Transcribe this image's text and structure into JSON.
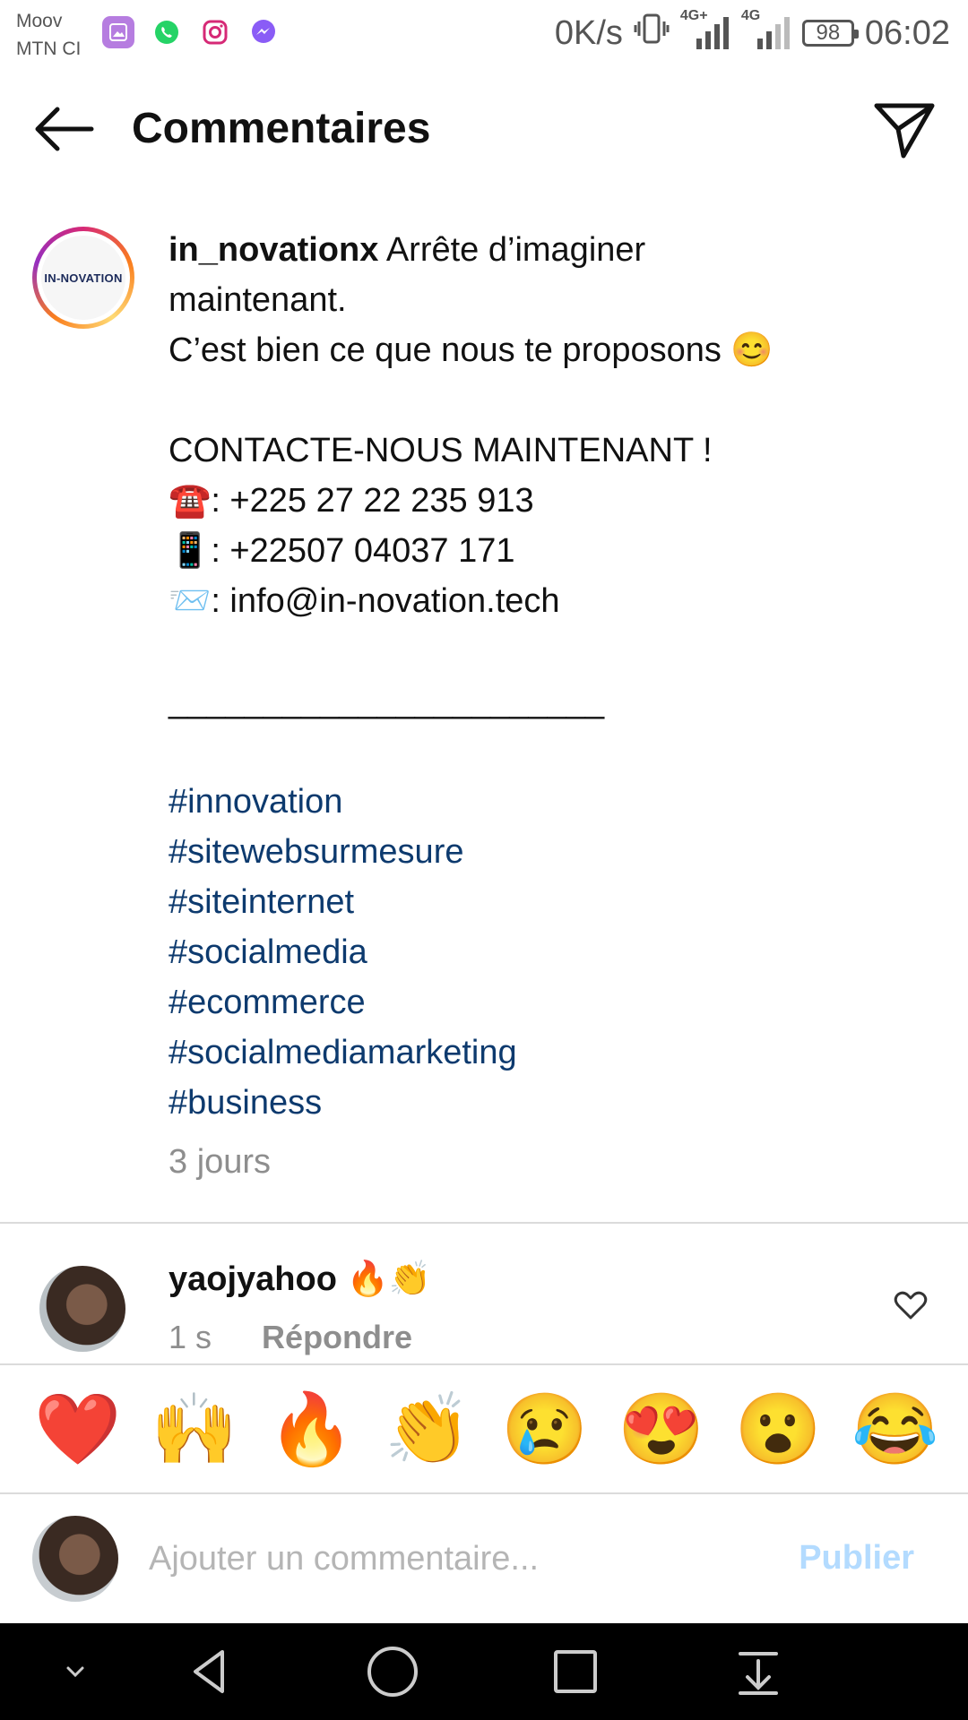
{
  "status_bar": {
    "carrier_line1": "Moov",
    "carrier_line2": "MTN CI",
    "net_speed": "0K/s",
    "battery": "98",
    "time": "06:02",
    "network_1": "4G+",
    "network_2": "4G"
  },
  "header": {
    "title": "Commentaires"
  },
  "caption": {
    "username": "in_novationx",
    "avatar_text": "IN-NOVATION",
    "lines": [
      " Arrête d’imaginer",
      "maintenant.",
      "C’est bien ce que nous te proposons 😊",
      "",
      "CONTACTE-NOUS MAINTENANT !",
      "☎️: +225 27 22 235 913",
      "📱: +22507 04037 171",
      "📨: info@in-novation.tech",
      "",
      "_______________________",
      ""
    ],
    "hashtags": [
      "#innovation",
      "#sitewebsurmesure",
      "#siteinternet",
      "#socialmedia",
      "#ecommerce",
      "#socialmediamarketing",
      "#business"
    ],
    "time": "3 jours"
  },
  "comment": {
    "username": "yaojyahoo",
    "emojis": "🔥👏",
    "time": "1 s",
    "reply_label": "Répondre"
  },
  "reactions": [
    "❤️",
    "🙌",
    "🔥",
    "👏",
    "😢",
    "😍",
    "😮",
    "😂"
  ],
  "composer": {
    "placeholder": "Ajouter un commentaire...",
    "publish_label": "Publier"
  },
  "colors": {
    "hashtag": "#0d3a6e",
    "publish_disabled": "#b3dbff",
    "meta_gray": "#8e8e8e"
  }
}
